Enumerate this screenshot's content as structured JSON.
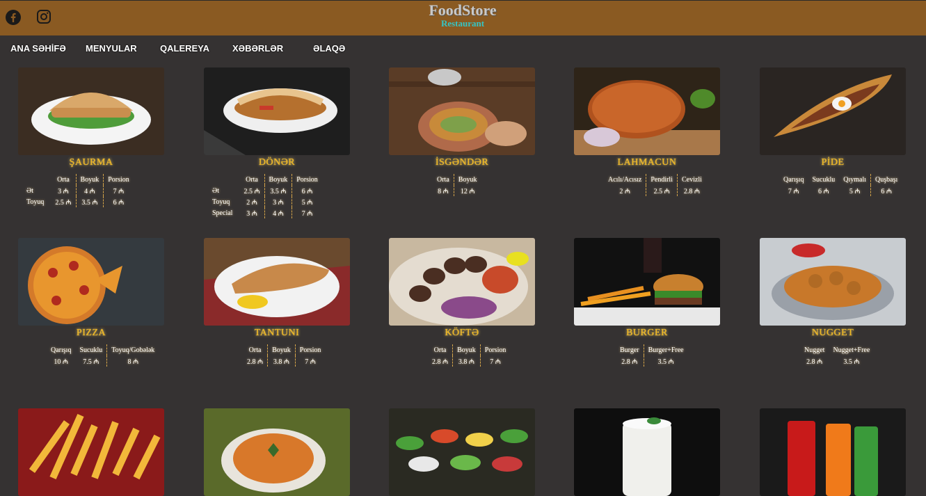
{
  "header": {
    "brand_name": "FoodStore",
    "brand_sub": "Restaurant",
    "background": "#8a5a22",
    "social": [
      "facebook-icon",
      "instagram-icon"
    ]
  },
  "nav": [
    "ANA SƏHİFƏ",
    "MENYULAR",
    "QALEREYA",
    "XƏBƏRLƏR",
    "ƏLAQƏ"
  ],
  "menu": [
    {
      "title": "ŞAURMA",
      "cols": [
        "Orta",
        "Boyuk",
        "Porsion"
      ],
      "rows": [
        {
          "label": "Ət",
          "vals": [
            "3 ₼",
            "4 ₼",
            "7 ₼"
          ]
        },
        {
          "label": "Toyuq",
          "vals": [
            "2.5 ₼",
            "3.5 ₼",
            "6 ₼"
          ]
        }
      ]
    },
    {
      "title": "DÖNƏR",
      "cols": [
        "Orta",
        "Boyuk",
        "Porsion"
      ],
      "rows": [
        {
          "label": "Ət",
          "vals": [
            "2.5 ₼",
            "3.5 ₼",
            "6 ₼"
          ]
        },
        {
          "label": "Toyuq",
          "vals": [
            "2 ₼",
            "3 ₼",
            "5 ₼"
          ]
        },
        {
          "label": "Special",
          "vals": [
            "3 ₼",
            "4 ₼",
            "7 ₼"
          ]
        }
      ]
    },
    {
      "title": "İSGƏNDƏR",
      "cols": [
        "Orta",
        "Boyuk"
      ],
      "rows": [
        {
          "label": "",
          "vals": [
            "8 ₼",
            "12 ₼"
          ]
        }
      ]
    },
    {
      "title": "LAHMACUN",
      "cols": [
        "Acılı/Acısız",
        "Pendirli",
        "Cevizli"
      ],
      "rows": [
        {
          "label": "",
          "vals": [
            "2 ₼",
            "2.5 ₼",
            "2.8 ₼"
          ]
        }
      ]
    },
    {
      "title": "PİDE",
      "cols": [
        "Qarışıq",
        "Sucuklu",
        "Qıymalı",
        "Quşbaşı"
      ],
      "rows": [
        {
          "label": "",
          "vals": [
            "7 ₼",
            "6 ₼",
            "5 ₼",
            "6 ₼"
          ]
        }
      ]
    },
    {
      "title": "PIZZA",
      "cols": [
        "Qarışıq",
        "Sucuklu",
        "Toyuq/Gobələk"
      ],
      "rows": [
        {
          "label": "",
          "vals": [
            "10 ₼",
            "7.5 ₼",
            "8 ₼"
          ]
        }
      ]
    },
    {
      "title": "TANTUNI",
      "cols": [
        "Orta",
        "Boyuk",
        "Porsion"
      ],
      "rows": [
        {
          "label": "",
          "vals": [
            "2.8 ₼",
            "3.8 ₼",
            "7 ₼"
          ]
        }
      ]
    },
    {
      "title": "KÖFTƏ",
      "cols": [
        "Orta",
        "Boyuk",
        "Porsion"
      ],
      "rows": [
        {
          "label": "",
          "vals": [
            "2.8 ₼",
            "3.8 ₼",
            "7 ₼"
          ]
        }
      ]
    },
    {
      "title": "BURGER",
      "cols": [
        "Burger",
        "Burger+Free"
      ],
      "rows": [
        {
          "label": "",
          "vals": [
            "2.8 ₼",
            "3.5 ₼"
          ]
        }
      ]
    },
    {
      "title": "NUGGET",
      "cols": [
        "Nugget",
        "Nugget+Free"
      ],
      "rows": [
        {
          "label": "",
          "vals": [
            "2.8 ₼",
            "3.5 ₼"
          ]
        }
      ]
    }
  ],
  "bottom_row_photos": [
    "fries-photo",
    "soup-photo",
    "salad-bar-photo",
    "ayran-photo",
    "soda-cans-photo"
  ]
}
